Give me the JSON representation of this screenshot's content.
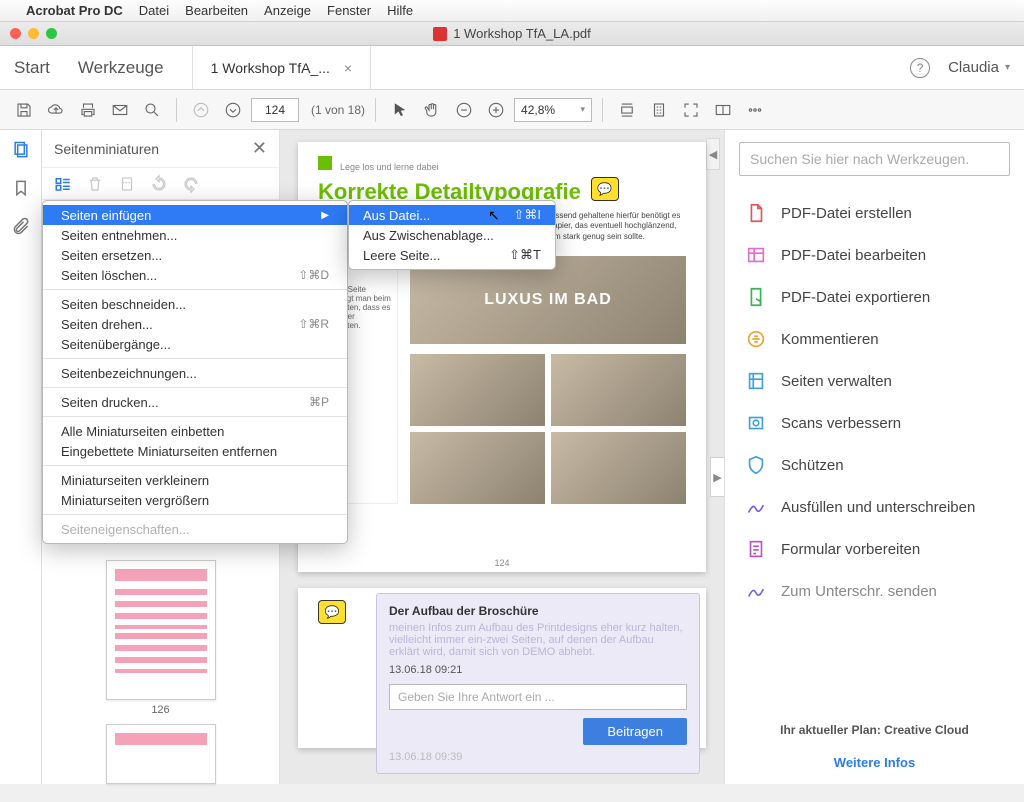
{
  "mac_menu": {
    "app": "Acrobat Pro DC",
    "items": [
      "Datei",
      "Bearbeiten",
      "Anzeige",
      "Fenster",
      "Hilfe"
    ]
  },
  "window_title": "1 Workshop TfA_LA.pdf",
  "nav": {
    "start": "Start",
    "tools": "Werkzeuge",
    "tab": "1 Workshop TfA_...",
    "tab_close": "×",
    "user": "Claudia"
  },
  "toolbar": {
    "page_value": "124",
    "page_count": "(1 von 18)",
    "zoom": "42,8%"
  },
  "thumbs": {
    "title": "Seitenminiaturen",
    "labels": [
      "126",
      ""
    ]
  },
  "ctx": {
    "items": [
      {
        "label": "Seiten einfügen",
        "arrow": true,
        "hl": true
      },
      {
        "label": "Seiten entnehmen..."
      },
      {
        "label": "Seiten ersetzen..."
      },
      {
        "label": "Seiten löschen...",
        "sc": "⇧⌘D"
      }
    ],
    "sep1": true,
    "items2": [
      {
        "label": "Seiten beschneiden..."
      },
      {
        "label": "Seiten drehen...",
        "sc": "⇧⌘R"
      },
      {
        "label": "Seitenübergänge..."
      }
    ],
    "items3": [
      {
        "label": "Seitenbezeichnungen..."
      }
    ],
    "items4": [
      {
        "label": "Seiten drucken...",
        "sc": "⌘P"
      }
    ],
    "items5": [
      {
        "label": "Alle Miniaturseiten einbetten"
      },
      {
        "label": "Eingebettete Miniaturseiten entfernen"
      }
    ],
    "items6": [
      {
        "label": "Miniaturseiten verkleinern"
      },
      {
        "label": "Miniaturseiten vergrößern"
      }
    ],
    "items7": [
      {
        "label": "Seiteneigenschaften...",
        "disabled": true
      }
    ]
  },
  "submenu": {
    "items": [
      {
        "label": "Aus Datei...",
        "sc": "⇧⌘I",
        "hl": true
      },
      {
        "label": "Aus Zwischenablage..."
      },
      {
        "label": "Leere Seite...",
        "sc": "⇧⌘T"
      }
    ]
  },
  "page": {
    "crumb": "Lege los und lerne dabei",
    "heading": "Korrekte Detailtypografie",
    "para": "Von Blindtexten in Fließlichten ist Platzhalter zu vermeiden; professionelle Druckvorlagen bedingen Mehrwert genauso viel hochwertige Bilder der passend gehaltene hierfür benötigt es genügend Papier, das eventuell hochglänzend, aber vor allem stark genug sein sollte.",
    "note": "Diese Seite benötigt man beim Begleiten, dass es sich hier gelernten.",
    "photolabel": "LUXUS IM BAD",
    "pageno": "124"
  },
  "comment": {
    "heading": "Der Aufbau der Broschüre",
    "body": "meinen Infos zum Aufbau des Printdesigns eher kurz halten, vielleicht immer ein-zwei Seiten, auf denen der Aufbau erklärt wird, damit sich von DEMO abhebt.",
    "timestamp": "13.06.18  09:21",
    "reply_placeholder": "Geben Sie Ihre Antwort ein ...",
    "contribute": "Beitragen",
    "ts2": "13.06.18  09:39"
  },
  "tools": {
    "search_placeholder": "Suchen Sie hier nach Werkzeugen.",
    "list": [
      {
        "label": "PDF-Datei erstellen",
        "color": "#e05555"
      },
      {
        "label": "PDF-Datei bearbeiten",
        "color": "#e26bd0"
      },
      {
        "label": "PDF-Datei exportieren",
        "color": "#3fae58"
      },
      {
        "label": "Kommentieren",
        "color": "#f0a030"
      },
      {
        "label": "Seiten verwalten",
        "color": "#3d9fe0"
      },
      {
        "label": "Scans verbessern",
        "color": "#3d9fe0"
      },
      {
        "label": "Schützen",
        "color": "#3d9fe0"
      },
      {
        "label": "Ausfüllen und unterschreiben",
        "color": "#7060e0"
      },
      {
        "label": "Formular vorbereiten",
        "color": "#c050c0"
      },
      {
        "label": "Zum Unterschr. senden",
        "color": "#6a6ae0",
        "cut": true
      }
    ],
    "plan": "Ihr aktueller Plan: Creative Cloud",
    "more": "Weitere Infos"
  }
}
